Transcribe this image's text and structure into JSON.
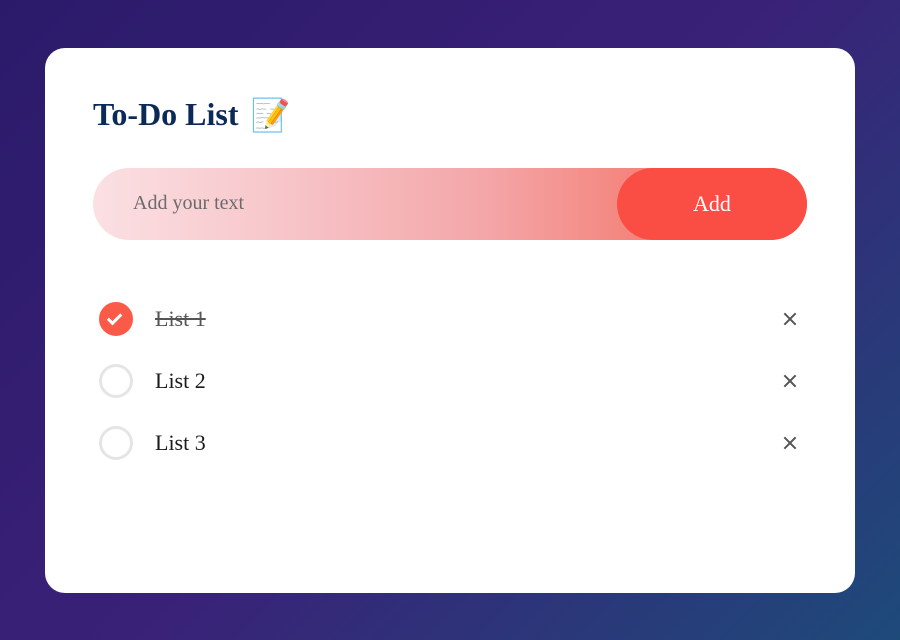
{
  "title": "To-Do List",
  "title_icon": "📝",
  "input": {
    "placeholder": "Add your text",
    "value": ""
  },
  "add_button_label": "Add",
  "items": [
    {
      "label": "List 1",
      "checked": true
    },
    {
      "label": "List 2",
      "checked": false
    },
    {
      "label": "List 3",
      "checked": false
    }
  ],
  "colors": {
    "accent": "#fa4d44",
    "title": "#0b2a57"
  }
}
